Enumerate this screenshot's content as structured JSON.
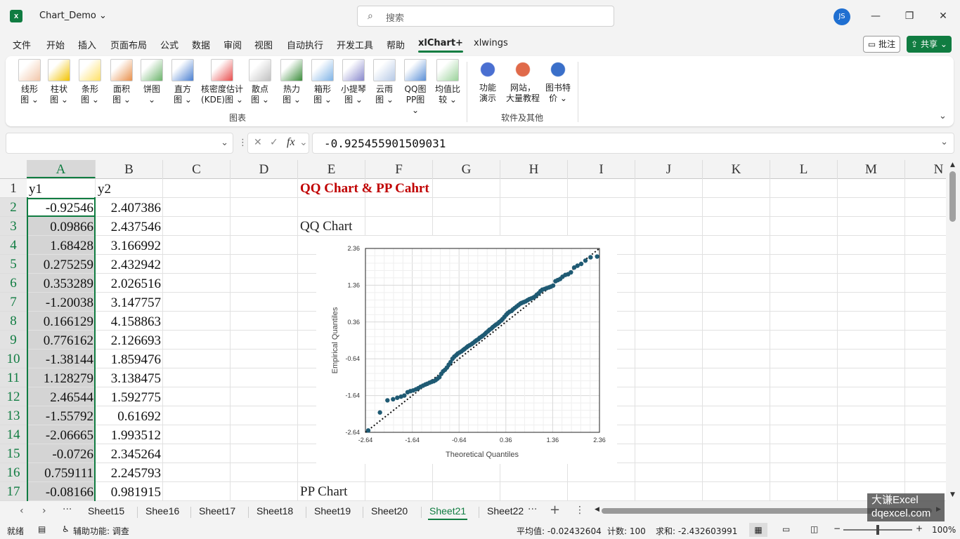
{
  "app": {
    "doc_title": "Chart_Demo",
    "search_placeholder": "搜索",
    "user_initials": "JS"
  },
  "menu": {
    "items": [
      "文件",
      "开始",
      "插入",
      "页面布局",
      "公式",
      "数据",
      "审阅",
      "视图",
      "自动执行",
      "开发工具",
      "帮助",
      "xlChart+",
      "xlwings"
    ],
    "active": "xlChart+",
    "comment": "批注",
    "share": "共享"
  },
  "ribbon": {
    "chart_buttons": [
      {
        "l1": "线形",
        "l2": "图 ⌄"
      },
      {
        "l1": "柱状",
        "l2": "图 ⌄"
      },
      {
        "l1": "条形",
        "l2": "图 ⌄"
      },
      {
        "l1": "面积",
        "l2": "图 ⌄"
      },
      {
        "l1": "饼图",
        "l2": "⌄"
      },
      {
        "l1": "直方",
        "l2": "图 ⌄"
      },
      {
        "l1": "核密度估计",
        "l2": "(KDE)图 ⌄"
      },
      {
        "l1": "散点",
        "l2": "图 ⌄"
      },
      {
        "l1": "热力",
        "l2": "图 ⌄"
      },
      {
        "l1": "箱形",
        "l2": "图 ⌄"
      },
      {
        "l1": "小提琴",
        "l2": "图 ⌄"
      },
      {
        "l1": "云雨",
        "l2": "图 ⌄"
      },
      {
        "l1": "QQ图",
        "l2": "PP图 ⌄"
      },
      {
        "l1": "均值比",
        "l2": "较 ⌄"
      }
    ],
    "group_chart": "图表",
    "other_buttons": [
      {
        "l1": "功能",
        "l2": "演示"
      },
      {
        "l1": "网站，",
        "l2": "大量教程"
      },
      {
        "l1": "图书特",
        "l2": "价 ⌄"
      }
    ],
    "group_other": "软件及其他"
  },
  "formula_bar": {
    "fx": "fx",
    "value": "-0.925455901509031"
  },
  "columns": [
    "A",
    "B",
    "C",
    "D",
    "E",
    "F",
    "G",
    "H",
    "I",
    "J",
    "K",
    "L",
    "M",
    "N"
  ],
  "rows": [
    "1",
    "2",
    "3",
    "4",
    "5",
    "6",
    "7",
    "8",
    "9",
    "10",
    "11",
    "12",
    "13",
    "14",
    "15",
    "16",
    "17"
  ],
  "data": {
    "header": [
      "y1",
      "y2"
    ],
    "y1": [
      "-0.92546",
      "0.09866",
      "1.68428",
      "0.275259",
      "0.353289",
      "-1.20038",
      "0.166129",
      "0.776162",
      "-1.38144",
      "1.128279",
      "2.46544",
      "-1.55792",
      "-2.06665",
      "-0.0726",
      "0.759111",
      "-0.08166"
    ],
    "y2": [
      "2.407386",
      "2.437546",
      "3.166992",
      "2.432942",
      "2.026516",
      "3.147757",
      "4.158863",
      "2.126693",
      "1.859476",
      "3.138475",
      "1.592775",
      "0.61692",
      "1.993512",
      "2.345264",
      "2.245793",
      "0.981915"
    ]
  },
  "sheet_text": {
    "title": "QQ Chart & PP Cahrt",
    "qq": "QQ Chart",
    "pp": "PP Chart"
  },
  "chart_data": {
    "type": "scatter",
    "xlabel": "Theoretical Quantiles",
    "ylabel": "Empirical Quantiles",
    "xlim": [
      -2.64,
      2.36
    ],
    "ylim": [
      -2.64,
      2.36
    ],
    "xticks": [
      "-2.64",
      "-1.64",
      "-0.64",
      "0.36",
      "1.36",
      "2.36"
    ],
    "yticks": [
      "-2.64",
      "-1.64",
      "-0.64",
      "0.36",
      "1.36",
      "2.36"
    ],
    "grid": true,
    "reference_line": {
      "x": [
        -2.64,
        2.36
      ],
      "y": [
        -2.64,
        2.36
      ],
      "style": "dotted"
    },
    "point_color": "#1f5a73",
    "x": [
      -2.58,
      -2.33,
      -2.17,
      -2.05,
      -1.96,
      -1.88,
      -1.81,
      -1.74,
      -1.68,
      -1.62,
      -1.56,
      -1.51,
      -1.46,
      -1.41,
      -1.36,
      -1.32,
      -1.27,
      -1.23,
      -1.18,
      -1.14,
      -1.1,
      -1.06,
      -1.02,
      -0.98,
      -0.94,
      -0.9,
      -0.86,
      -0.82,
      -0.78,
      -0.74,
      -0.7,
      -0.67,
      -0.63,
      -0.59,
      -0.55,
      -0.52,
      -0.48,
      -0.45,
      -0.41,
      -0.37,
      -0.34,
      -0.3,
      -0.27,
      -0.23,
      -0.2,
      -0.16,
      -0.13,
      -0.09,
      -0.06,
      -0.02,
      0.01,
      0.05,
      0.08,
      0.12,
      0.15,
      0.19,
      0.22,
      0.26,
      0.29,
      0.33,
      0.37,
      0.4,
      0.44,
      0.48,
      0.51,
      0.55,
      0.59,
      0.63,
      0.67,
      0.7,
      0.74,
      0.78,
      0.82,
      0.86,
      0.9,
      0.94,
      0.98,
      1.02,
      1.06,
      1.1,
      1.14,
      1.19,
      1.23,
      1.28,
      1.32,
      1.37,
      1.42,
      1.47,
      1.52,
      1.57,
      1.63,
      1.69,
      1.75,
      1.82,
      1.89,
      1.97,
      2.06,
      2.17,
      2.31
    ],
    "y": [
      -2.59,
      -2.1,
      -1.77,
      -1.74,
      -1.7,
      -1.67,
      -1.64,
      -1.55,
      -1.52,
      -1.5,
      -1.47,
      -1.44,
      -1.4,
      -1.37,
      -1.34,
      -1.32,
      -1.29,
      -1.27,
      -1.25,
      -1.22,
      -1.18,
      -1.14,
      -1.05,
      -0.98,
      -0.94,
      -0.88,
      -0.8,
      -0.73,
      -0.64,
      -0.58,
      -0.54,
      -0.5,
      -0.47,
      -0.44,
      -0.4,
      -0.37,
      -0.33,
      -0.3,
      -0.27,
      -0.24,
      -0.21,
      -0.17,
      -0.14,
      -0.11,
      -0.07,
      -0.04,
      -0.01,
      0.03,
      0.07,
      0.11,
      0.15,
      0.18,
      0.22,
      0.26,
      0.29,
      0.32,
      0.36,
      0.4,
      0.44,
      0.5,
      0.56,
      0.6,
      0.64,
      0.66,
      0.7,
      0.74,
      0.78,
      0.82,
      0.86,
      0.88,
      0.9,
      0.92,
      0.95,
      0.98,
      1.0,
      1.02,
      1.05,
      1.1,
      1.14,
      1.2,
      1.24,
      1.26,
      1.28,
      1.3,
      1.32,
      1.35,
      1.47,
      1.5,
      1.53,
      1.59,
      1.64,
      1.66,
      1.71,
      1.84,
      1.89,
      1.94,
      2.03,
      2.12,
      2.14
    ]
  },
  "tabs": {
    "items": [
      "Sheet15",
      "Shee16",
      "Sheet17",
      "Sheet18",
      "Sheet19",
      "Sheet20",
      "Sheet21",
      "Sheet22"
    ],
    "active": "Sheet21"
  },
  "status": {
    "ready": "就绪",
    "accessibility": "辅助功能: 调查",
    "average": "平均值: -0.02432604",
    "count": "计数: 100",
    "sum": "求和: -2.432603991",
    "zoom": "100%"
  },
  "watermark": {
    "line1": "大谦Excel",
    "line2": "dqexcel.com"
  }
}
